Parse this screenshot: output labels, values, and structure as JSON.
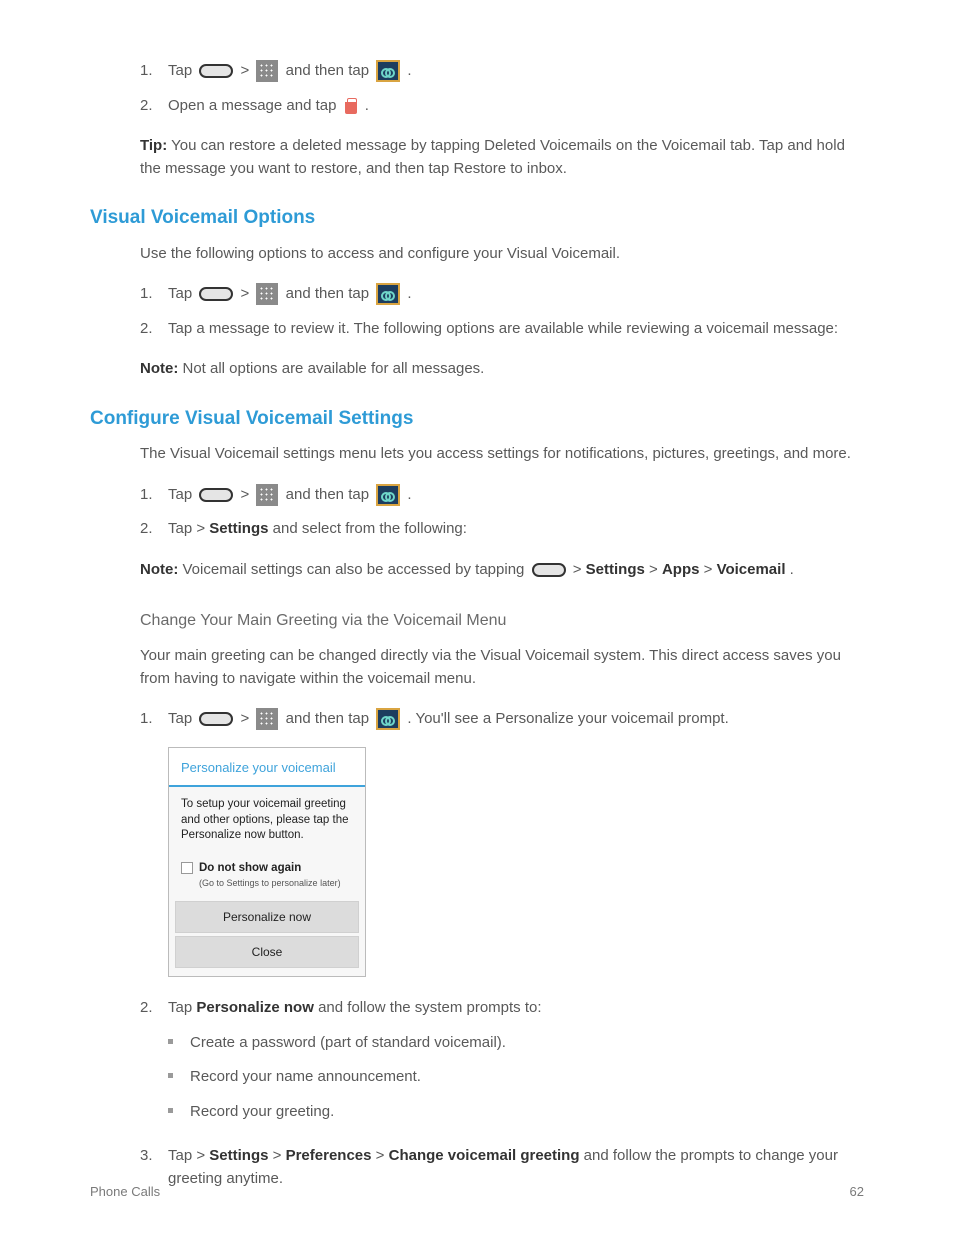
{
  "section1": {
    "intro_step_num": "1.",
    "intro_step_a": "Tap ",
    "intro_step_b": " > ",
    "intro_step_c": " and then tap ",
    "intro_step_d": ".",
    "step2_num": "2.",
    "step2_text_a": "Open a message and tap ",
    "step2_text_b": ".",
    "tip_label": "Tip:",
    "tip_text": " You can restore a deleted message by tapping Deleted Voicemails on the Voicemail tab. Tap and hold the message you want to restore, and then tap Restore to inbox."
  },
  "vvm_options": {
    "heading": "Visual Voicemail Options",
    "intro": "Use the following options to access and configure your Visual Voicemail.",
    "steps": {
      "s1_num": "1.",
      "s1_a": "Tap ",
      "s1_b": " > ",
      "s1_c": " and then tap ",
      "s1_d": ".",
      "s2_num": "2.",
      "s2_text": "Tap a message to review it. The following options are available while reviewing a voicemail message:",
      "note_label": "Note:",
      "note_text": " Not all options are available for all messages."
    }
  },
  "configure_section": {
    "heading": "Configure Visual Voicemail Settings",
    "intro": "The Visual Voicemail settings menu lets you access settings for notifications, pictures, greetings, and more.",
    "s1_num": "1.",
    "s1_a": "Tap ",
    "s1_b": " > ",
    "s1_c": " and then tap ",
    "s1_d": ".",
    "s2_num": "2.",
    "s2_a": "Tap ",
    "s2_b": " > ",
    "s2_settings": "Settings",
    "s2_c": " and select from the following:",
    "note_label": "Note:",
    "note_text_a": " Voicemail settings can also be accessed by tapping ",
    "note_text_b": " > ",
    "note_settings": "Settings",
    "note_text_c": " > ",
    "note_apps": "Apps",
    "note_text_d": " > ",
    "note_voicemail": "Voicemail",
    "note_text_e": "."
  },
  "greeting_section": {
    "subhead": "Change Your Main Greeting via the Voicemail Menu",
    "intro": "Your main greeting can be changed directly via the Visual Voicemail system. This direct access saves you from having to navigate within the voicemail menu.",
    "s1_num": "1.",
    "s1_a": "Tap ",
    "s1_b": " > ",
    "s1_c": " and then tap ",
    "s1_d": ". You'll see a Personalize your voicemail prompt."
  },
  "dialog": {
    "title": "Personalize your voicemail",
    "body": "To setup your voicemail greeting and other options, please tap the Personalize now button.",
    "checkbox_primary": "Do not show again",
    "checkbox_secondary": "(Go to Settings to personalize later)",
    "btn_personalize": "Personalize now",
    "btn_close": "Close"
  },
  "post_dialog": {
    "s2_num": "2.",
    "s2_a": "Tap ",
    "s2_personalize": "Personalize now",
    "s2_b": " and follow the system prompts to:",
    "bullets": [
      "Create a password (part of standard voicemail).",
      "Record your name announcement.",
      "Record your greeting."
    ],
    "s3_num": "3.",
    "s3_a": "Tap ",
    "s3_b": " > ",
    "s3_settings": "Settings",
    "s3_c": " > ",
    "s3_pref": "Preferences",
    "s3_d": " > ",
    "s3_greet": "Change voicemail greeting",
    "s3_e": " and follow the prompts to change your greeting anytime."
  },
  "footer": {
    "left": "Phone Calls",
    "right": "62"
  }
}
